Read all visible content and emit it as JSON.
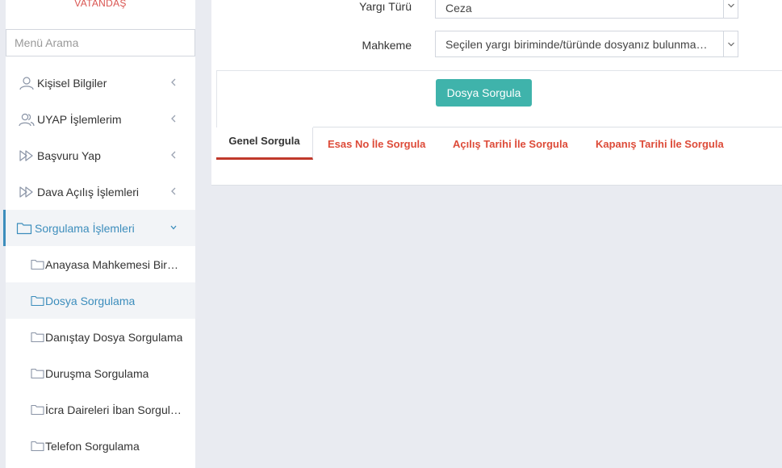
{
  "sidebar": {
    "brand": "VATANDAŞ",
    "search_placeholder": "Menü Arama",
    "items": [
      {
        "label": "Kişisel Bilgiler",
        "icon": "user-icon"
      },
      {
        "label": "UYAP İşlemlerim",
        "icon": "users-icon"
      },
      {
        "label": "Başvuru Yap",
        "icon": "forward-icon"
      },
      {
        "label": "Dava Açılış İşlemleri",
        "icon": "forward-icon"
      },
      {
        "label": "Sorgulama İşlemleri",
        "icon": "folder-icon",
        "expanded": true
      }
    ],
    "subitems": [
      {
        "label": "Anayasa Mahkemesi Bireysel Başvuru"
      },
      {
        "label": "Dosya Sorgulama"
      },
      {
        "label": "Danıştay Dosya Sorgulama"
      },
      {
        "label": "Duruşma Sorgulama"
      },
      {
        "label": "İcra Daireleri İban Sorgulama"
      },
      {
        "label": "Telefon Sorgulama"
      }
    ]
  },
  "form": {
    "yargi_turu_label": "Yargı Türü",
    "yargi_turu_value": "Ceza",
    "mahkeme_label": "Mahkeme",
    "mahkeme_value": "Seçilen yargı biriminde/türünde dosyanız bulunmamaktadır"
  },
  "query_button": "Dosya Sorgula",
  "tabs": [
    {
      "label": "Genel Sorgula",
      "active": true
    },
    {
      "label": "Esas No İle Sorgula"
    },
    {
      "label": "Açılış Tarihi İle Sorgula"
    },
    {
      "label": "Kapanış Tarihi İle Sorgula"
    }
  ],
  "colors": {
    "accent": "#3c8dbc",
    "button": "#3fb3ab",
    "tab_red": "#dd4b39",
    "active_tab_underline": "#c0392b"
  }
}
